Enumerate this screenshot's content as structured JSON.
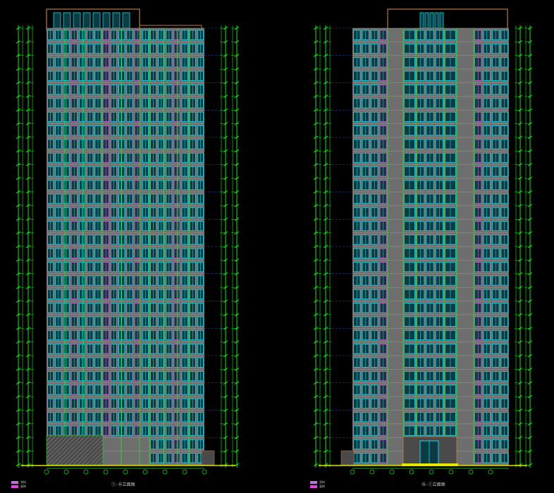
{
  "drawing": {
    "background": "#000000",
    "colors": {
      "dim_line": "#19e619",
      "facade": "#6e6e6e",
      "facade_dark": "#4a4a4a",
      "window_frame": "#18d7e6",
      "window_glass": "#0c3b44",
      "accent": "#c56ad8",
      "outline": "#b87a4a",
      "ground": "#e6e600",
      "text": "#c8c8c8",
      "grid_blue": "#3a5fd9"
    },
    "floors": 32
  },
  "elevations": [
    {
      "id": "left",
      "title": "①-⑯立面图",
      "legend": [
        "涂料",
        "面砖"
      ]
    },
    {
      "id": "right",
      "title": "⑯-①立面图",
      "legend": [
        "涂料",
        "面砖"
      ]
    }
  ]
}
